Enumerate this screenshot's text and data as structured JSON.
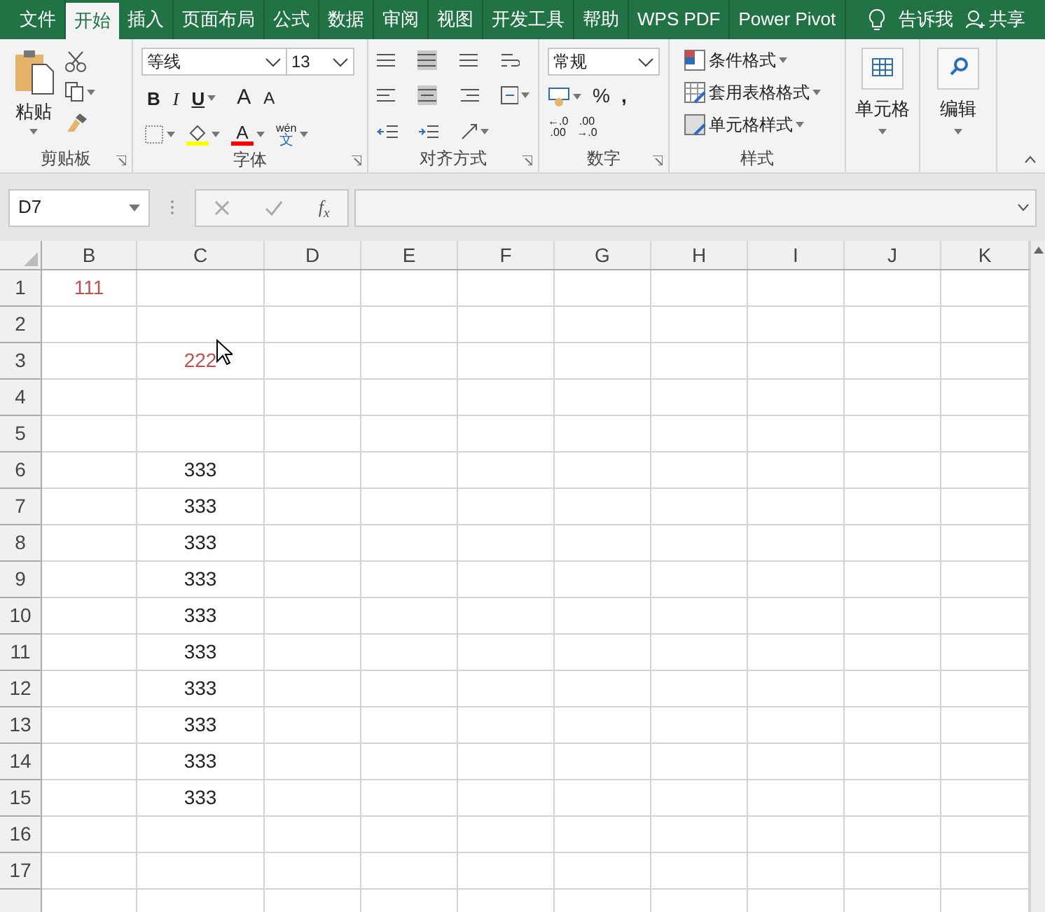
{
  "ribbon_tabs": [
    {
      "label": "文件",
      "selected": false
    },
    {
      "label": "开始",
      "selected": true
    },
    {
      "label": "插入",
      "selected": false
    },
    {
      "label": "页面布局",
      "selected": false
    },
    {
      "label": "公式",
      "selected": false
    },
    {
      "label": "数据",
      "selected": false
    },
    {
      "label": "审阅",
      "selected": false
    },
    {
      "label": "视图",
      "selected": false
    },
    {
      "label": "开发工具",
      "selected": false
    },
    {
      "label": "帮助",
      "selected": false
    },
    {
      "label": "WPS PDF",
      "selected": false
    },
    {
      "label": "Power Pivot",
      "selected": false
    }
  ],
  "tell_me": "告诉我",
  "share": "共享",
  "clipboard": {
    "label": "剪贴板",
    "paste": "粘贴"
  },
  "font": {
    "label": "字体",
    "font_name": "等线",
    "font_size": "13",
    "bold": "B",
    "italic": "I",
    "underline": "U",
    "grow": "A",
    "shrink": "A",
    "font_color": "A",
    "phonetic_top": "wén",
    "phonetic_bottom": "文"
  },
  "alignment": {
    "label": "对齐方式"
  },
  "number": {
    "label": "数字",
    "format": "常规",
    "percent": "%",
    "comma": ",",
    "increase_decimal": [
      "←.0",
      ".00"
    ],
    "decrease_decimal": [
      ".00",
      "→.0"
    ]
  },
  "styles": {
    "label": "样式",
    "items": [
      "条件格式",
      "套用表格格式",
      "单元格样式"
    ]
  },
  "cells_group": {
    "label": "单元格"
  },
  "editing": {
    "label": "编辑"
  },
  "formula_bar": {
    "name_box": "D7",
    "function_button": "f$_{x}$"
  },
  "sheet": {
    "columns": [
      "B",
      "C",
      "D",
      "E",
      "F",
      "G",
      "H",
      "I",
      "J",
      "K"
    ],
    "rows": [
      {
        "header": "1",
        "cells": {
          "B": {
            "text": "111",
            "color": "#c0504d"
          }
        }
      },
      {
        "header": "2",
        "cells": {}
      },
      {
        "header": "3",
        "cells": {
          "C": {
            "text": "222",
            "color": "#c0504d"
          }
        }
      },
      {
        "header": "4",
        "cells": {}
      },
      {
        "header": "5",
        "cells": {}
      },
      {
        "header": "6",
        "cells": {
          "C": {
            "text": "333",
            "color": "#222222"
          }
        }
      },
      {
        "header": "7",
        "cells": {
          "C": {
            "text": "333",
            "color": "#222222"
          }
        }
      },
      {
        "header": "8",
        "cells": {
          "C": {
            "text": "333",
            "color": "#222222"
          }
        }
      },
      {
        "header": "9",
        "cells": {
          "C": {
            "text": "333",
            "color": "#222222"
          }
        }
      },
      {
        "header": "10",
        "cells": {
          "C": {
            "text": "333",
            "color": "#222222"
          }
        }
      },
      {
        "header": "11",
        "cells": {
          "C": {
            "text": "333",
            "color": "#222222"
          }
        }
      },
      {
        "header": "12",
        "cells": {
          "C": {
            "text": "333",
            "color": "#222222"
          }
        }
      },
      {
        "header": "13",
        "cells": {
          "C": {
            "text": "333",
            "color": "#222222"
          }
        }
      },
      {
        "header": "14",
        "cells": {
          "C": {
            "text": "333",
            "color": "#222222"
          }
        }
      },
      {
        "header": "15",
        "cells": {
          "C": {
            "text": "333",
            "color": "#222222"
          }
        }
      },
      {
        "header": "16",
        "cells": {}
      },
      {
        "header": "17",
        "cells": {}
      }
    ]
  }
}
